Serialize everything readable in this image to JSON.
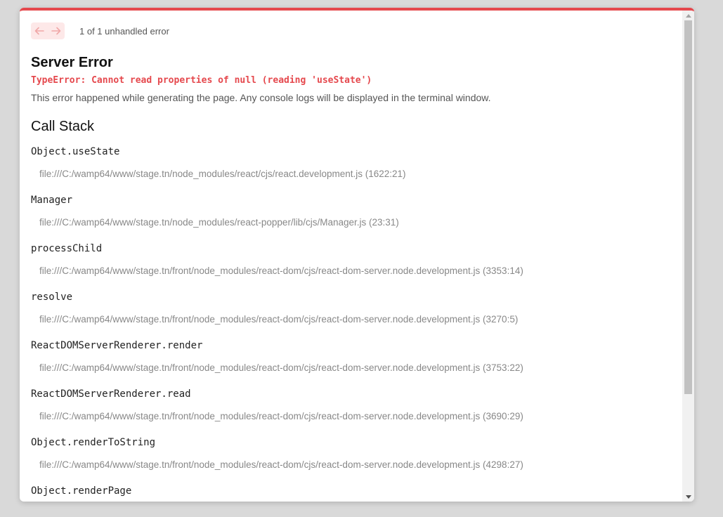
{
  "nav": {
    "prev_label": "←",
    "next_label": "→",
    "count_text": "1 of 1 unhandled error"
  },
  "error": {
    "title": "Server Error",
    "message": "TypeError: Cannot read properties of null (reading 'useState')",
    "description": "This error happened while generating the page. Any console logs will be displayed in the terminal window."
  },
  "callstack": {
    "title": "Call Stack",
    "frames": [
      {
        "fn": "Object.useState",
        "file": "file:///C:/wamp64/www/stage.tn/node_modules/react/cjs/react.development.js (1622:21)"
      },
      {
        "fn": "Manager",
        "file": "file:///C:/wamp64/www/stage.tn/node_modules/react-popper/lib/cjs/Manager.js (23:31)"
      },
      {
        "fn": "processChild",
        "file": "file:///C:/wamp64/www/stage.tn/front/node_modules/react-dom/cjs/react-dom-server.node.development.js (3353:14)"
      },
      {
        "fn": "resolve",
        "file": "file:///C:/wamp64/www/stage.tn/front/node_modules/react-dom/cjs/react-dom-server.node.development.js (3270:5)"
      },
      {
        "fn": "ReactDOMServerRenderer.render",
        "file": "file:///C:/wamp64/www/stage.tn/front/node_modules/react-dom/cjs/react-dom-server.node.development.js (3753:22)"
      },
      {
        "fn": "ReactDOMServerRenderer.read",
        "file": "file:///C:/wamp64/www/stage.tn/front/node_modules/react-dom/cjs/react-dom-server.node.development.js (3690:29)"
      },
      {
        "fn": "Object.renderToString",
        "file": "file:///C:/wamp64/www/stage.tn/front/node_modules/react-dom/cjs/react-dom-server.node.development.js (4298:27)"
      },
      {
        "fn": "Object.renderPage",
        "file": ""
      }
    ]
  },
  "colors": {
    "accent": "#e5484d",
    "nav_bg": "#fde8e8",
    "nav_fg": "#f0a8a8"
  },
  "icons": {
    "prev": "arrow-left-icon",
    "next": "arrow-right-icon",
    "scroll_up": "triangle-up-icon",
    "scroll_down": "triangle-down-icon"
  }
}
